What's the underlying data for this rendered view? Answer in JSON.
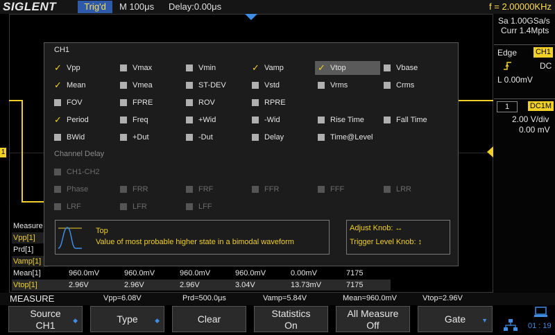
{
  "topbar": {
    "logo": "SIGLENT",
    "trig_status": "Trig'd",
    "timebase": "M 100μs",
    "delay": "Delay:0.00μs",
    "frequency": "f = 2.00000KHz"
  },
  "right_panel": {
    "sample_rate": "Sa 1.00GSa/s",
    "memory": "Curr 1.4Mpts",
    "trigger_type": "Edge",
    "trigger_source": "CH1",
    "trigger_coupling": "DC",
    "trigger_level": "L  0.00mV",
    "channel_number": "1",
    "channel_coupling": "DC1M",
    "volts_div": "2.00 V/div",
    "offset": "0.00 mV"
  },
  "dialog": {
    "channel_label": "CH1",
    "channel_delay_label": "Channel Delay",
    "items": [
      {
        "label": "Vpp",
        "checked": true
      },
      {
        "label": "Vmax",
        "checked": false
      },
      {
        "label": "Vmin",
        "checked": false
      },
      {
        "label": "Vamp",
        "checked": true
      },
      {
        "label": "Vtop",
        "checked": true
      },
      {
        "label": "Vbase",
        "checked": false
      },
      {
        "label": "Mean",
        "checked": true
      },
      {
        "label": "Vmea",
        "checked": false
      },
      {
        "label": "ST-DEV",
        "checked": false
      },
      {
        "label": "Vstd",
        "checked": false
      },
      {
        "label": "Vrms",
        "checked": false
      },
      {
        "label": "Crms",
        "checked": false
      },
      {
        "label": "FOV",
        "checked": false
      },
      {
        "label": "FPRE",
        "checked": false
      },
      {
        "label": "ROV",
        "checked": false
      },
      {
        "label": "RPRE",
        "checked": false
      },
      {
        "label": "Period",
        "checked": true
      },
      {
        "label": "Freq",
        "checked": false
      },
      {
        "label": "+Wid",
        "checked": false
      },
      {
        "label": "-Wid",
        "checked": false
      },
      {
        "label": "Rise Time",
        "checked": false
      },
      {
        "label": "Fall Time",
        "checked": false
      },
      {
        "label": "BWid",
        "checked": false
      },
      {
        "label": "+Dut",
        "checked": false
      },
      {
        "label": "-Dut",
        "checked": false
      },
      {
        "label": "Delay",
        "checked": false
      },
      {
        "label": "Time@Level",
        "checked": false
      }
    ],
    "delay_items": [
      {
        "label": "CH1-CH2"
      },
      {
        "label": "Phase"
      },
      {
        "label": "FRR"
      },
      {
        "label": "FRF"
      },
      {
        "label": "FFR"
      },
      {
        "label": "FFF"
      },
      {
        "label": "LRR"
      },
      {
        "label": "LRF"
      },
      {
        "label": "LFR"
      },
      {
        "label": "LFF"
      }
    ],
    "info_title": "Top",
    "info_description": "Value of most probable higher state in a bimodal waveform",
    "adjust_knob": "Adjust Knob: ↔",
    "trigger_level_knob": "Trigger Level Knob: ↕"
  },
  "stats": {
    "header": "Measure",
    "rows": [
      {
        "name": "Vpp[1]",
        "values": []
      },
      {
        "name": "Prd[1]",
        "values": []
      },
      {
        "name": "Vamp[1]",
        "values": []
      },
      {
        "name": "Mean[1]",
        "values": [
          "960.0mV",
          "960.0mV",
          "960.0mV",
          "960.0mV",
          "0.00mV",
          "7175"
        ]
      },
      {
        "name": "Vtop[1]",
        "values": [
          "2.96V",
          "2.96V",
          "2.96V",
          "3.04V",
          "13.73mV",
          "7175"
        ]
      }
    ]
  },
  "summary": {
    "title": "MEASURE",
    "vpp": "Vpp=6.08V",
    "prd": "Prd=500.0μs",
    "vamp": "Vamp=5.84V",
    "mean": "Mean=960.0mV",
    "vtop": "Vtop=2.96V"
  },
  "menu": {
    "source_l1": "Source",
    "source_l2": "CH1",
    "type": "Type",
    "clear": "Clear",
    "statistics_l1": "Statistics",
    "statistics_l2": "On",
    "all_measure_l1": "All Measure",
    "all_measure_l2": "Off",
    "gate": "Gate"
  },
  "status": {
    "clock": "01 : 19"
  },
  "colors": {
    "accent_blue": "#2f5aa9",
    "channel_yellow": "#f0d028"
  }
}
